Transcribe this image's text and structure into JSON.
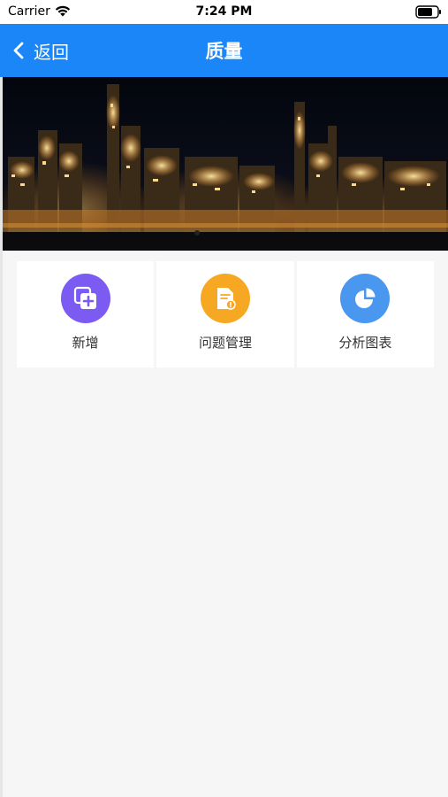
{
  "status_bar": {
    "carrier": "Carrier",
    "time": "7:24 PM",
    "wifi_icon": "wifi-icon",
    "battery_icon": "battery-icon"
  },
  "nav": {
    "back_label": "返回",
    "back_icon": "chevron-left-icon",
    "title": "质量",
    "background_color": "#1a86f7"
  },
  "banner": {
    "description_icon": "refinery-night-photo"
  },
  "grid": {
    "items": [
      {
        "label": "新增",
        "icon": "add-copy-icon",
        "color": "#7b5bf2"
      },
      {
        "label": "问题管理",
        "icon": "document-icon",
        "color": "#f7a823"
      },
      {
        "label": "分析图表",
        "icon": "pie-chart-icon",
        "color": "#4a97f0"
      }
    ]
  }
}
